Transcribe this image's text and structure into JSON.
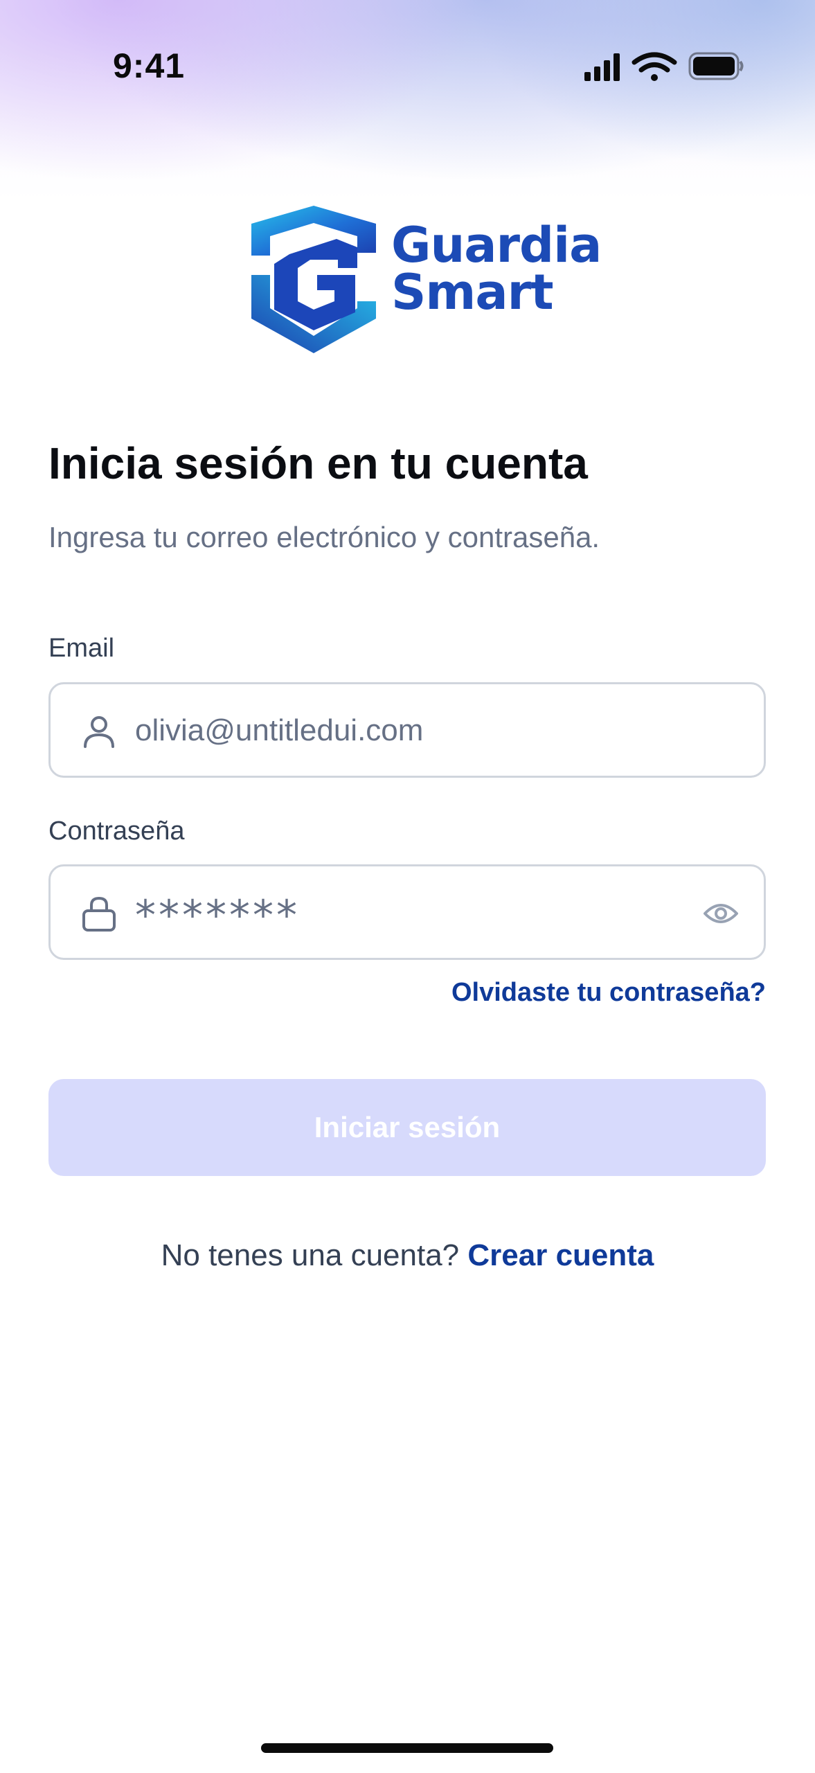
{
  "status_bar": {
    "time": "9:41"
  },
  "brand": {
    "line1": "Guardia",
    "line2": "Smart",
    "logo_letter": "G",
    "primary_color": "#1c4bb6",
    "accent_color": "#27c1ea"
  },
  "header": {
    "title": "Inicia sesión en tu cuenta",
    "subtitle": "Ingresa tu correo electrónico y contraseña."
  },
  "form": {
    "email": {
      "label": "Email",
      "value": "olivia@untitledui.com",
      "icon": "user-icon"
    },
    "password": {
      "label": "Contraseña",
      "value": "*******",
      "icon": "lock-icon",
      "toggle_icon": "eye-icon"
    },
    "forgot_password": "Olvidaste tu contraseña?",
    "submit_label": "Iniciar sesión",
    "submit_color": "#d7dafc"
  },
  "footer": {
    "prompt": "No tenes una cuenta?",
    "link": "Crear cuenta",
    "link_color": "#0f3a99"
  }
}
